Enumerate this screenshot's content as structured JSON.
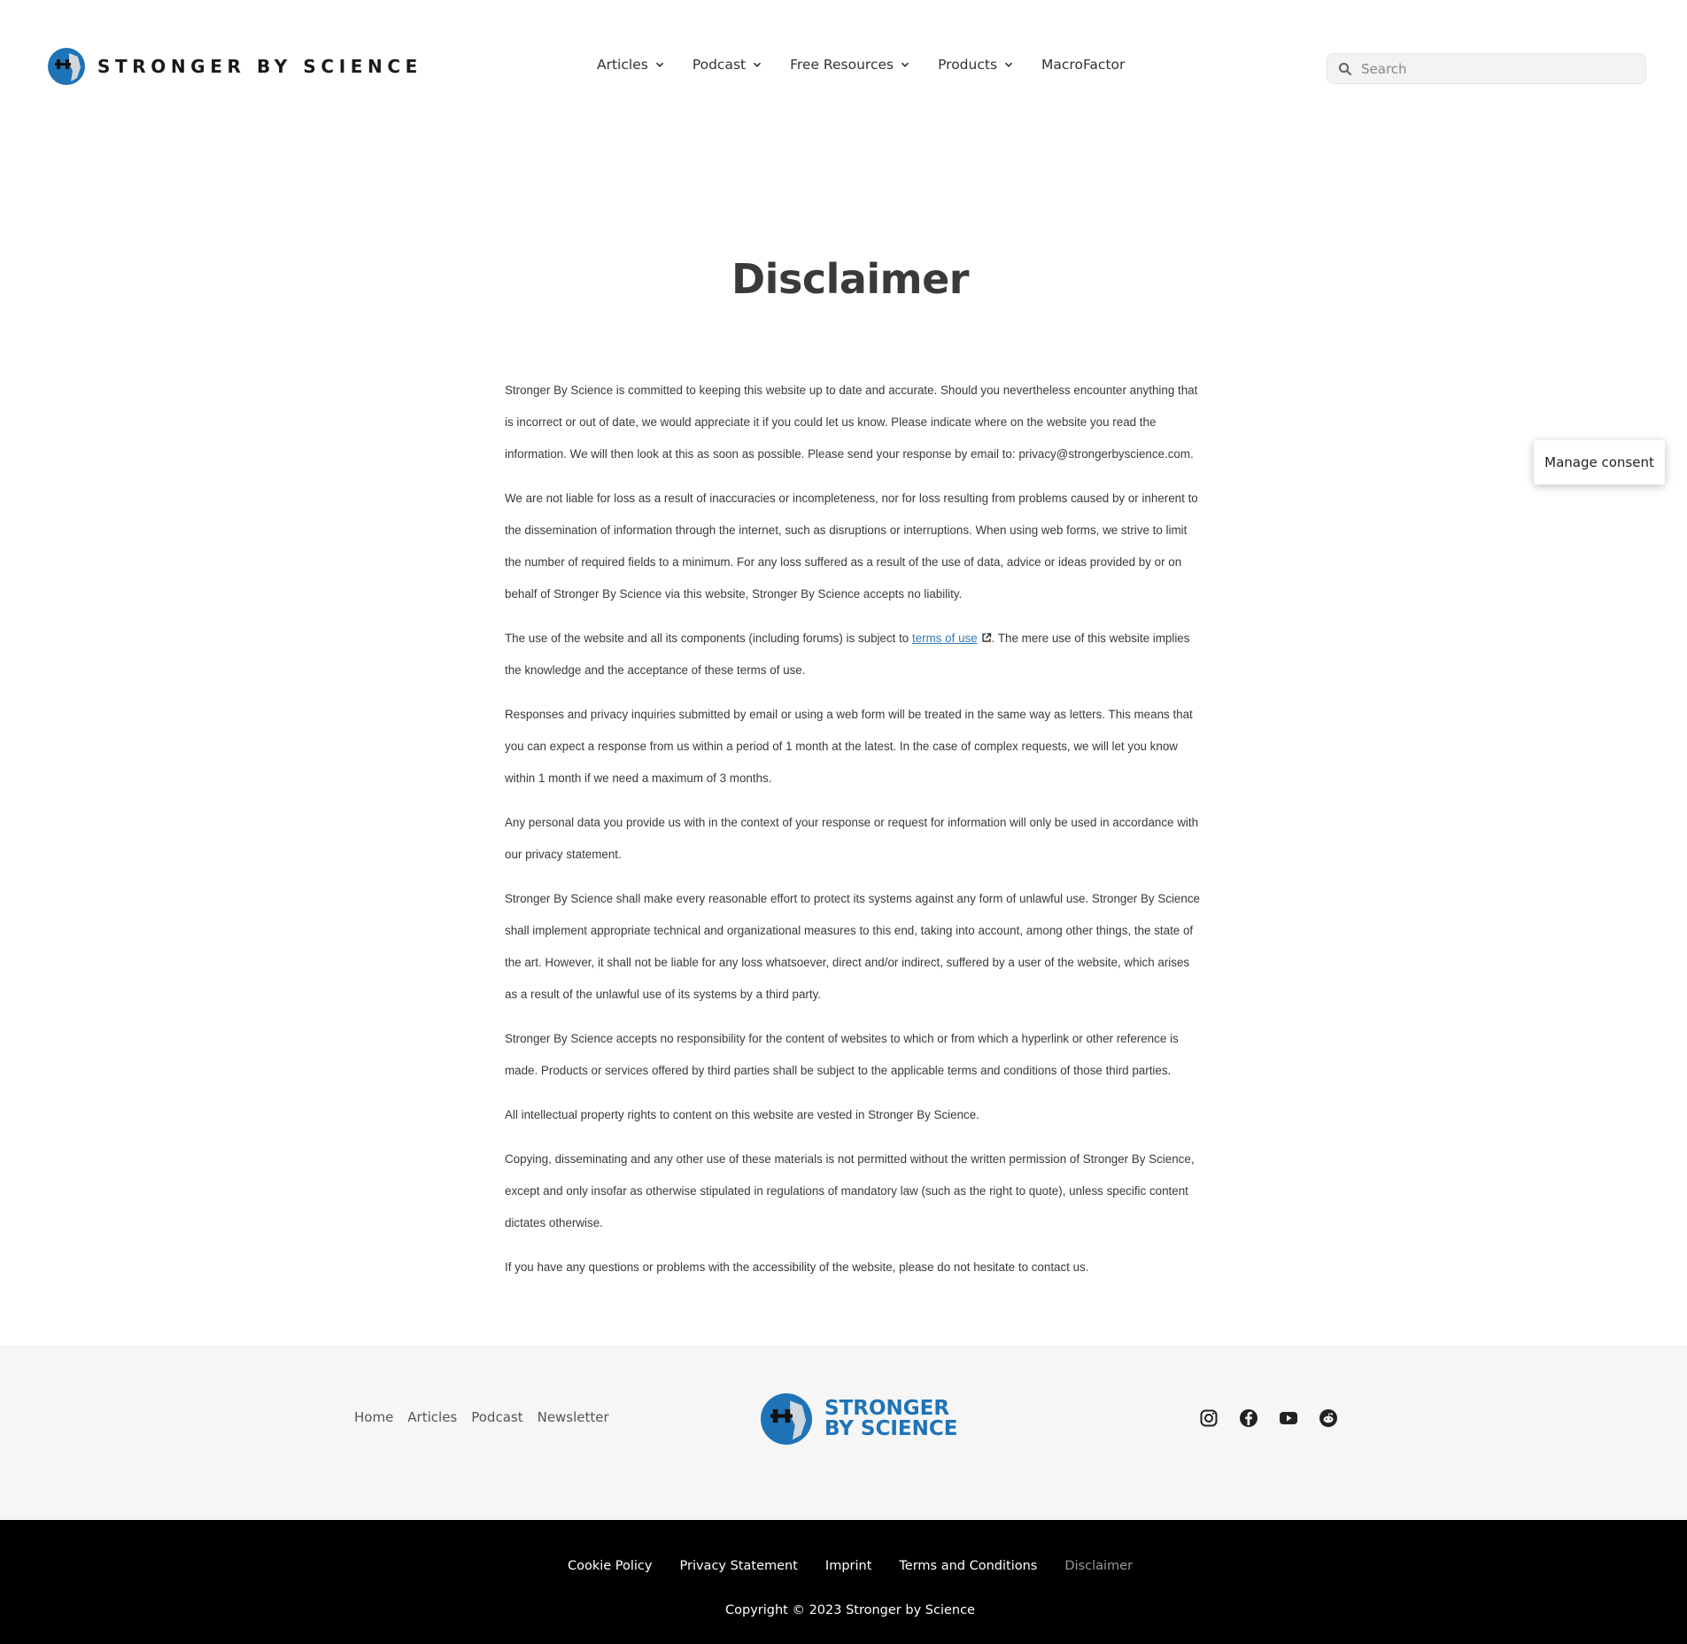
{
  "header": {
    "brand": "STRONGER BY SCIENCE",
    "nav": [
      {
        "label": "Articles",
        "dropdown": true
      },
      {
        "label": "Podcast",
        "dropdown": true
      },
      {
        "label": "Free Resources",
        "dropdown": true
      },
      {
        "label": "Products",
        "dropdown": true
      },
      {
        "label": "MacroFactor",
        "dropdown": false
      }
    ],
    "search_placeholder": "Search"
  },
  "page": {
    "title": "Disclaimer",
    "paragraphs": [
      "Stronger By Science is committed to keeping this website up to date and accurate. Should you nevertheless encounter anything that is incorrect or out of date, we would appreciate it if you could let us know. Please indicate where on the website you read the information. We will then look at this as soon as possible. Please send your response by email to: privacy@strongerbyscience.com.",
      "We are not liable for loss as a result of inaccuracies or incompleteness, nor for loss resulting from problems caused by or inherent to the dissemination of information through the internet, such as disruptions or interruptions. When using web forms, we strive to limit the number of required fields to a minimum. For any loss suffered as a result of the use of data, advice or ideas provided by or on behalf of Stronger By Science via this website, Stronger By Science accepts no liability.",
      {
        "before": "The use of the website and all its components (including forums) is subject to ",
        "link": "terms of use",
        "after": ". The mere use of this website implies the knowledge and the acceptance of these terms of use."
      },
      "Responses and privacy inquiries submitted by email or using a web form will be treated in the same way as letters. This means that you can expect a response from us within a period of 1 month at the latest. In the case of complex requests, we will let you know within 1 month if we need a maximum of 3 months.",
      "Any personal data you provide us with in the context of your response or request for information will only be used in accordance with our privacy statement.",
      "Stronger By Science shall make every reasonable effort to protect its systems against any form of unlawful use. Stronger By Science shall implement appropriate technical and organizational measures to this end, taking into account, among other things, the state of the art. However, it shall not be liable for any loss whatsoever, direct and/or indirect, suffered by a user of the website, which arises as a result of the unlawful use of its systems by a third party.",
      "Stronger By Science accepts no responsibility for the content of websites to which or from which a hyperlink or other reference is made. Products or services offered by third parties shall be subject to the applicable terms and conditions of those third parties.",
      "All intellectual property rights to content on this website are vested in Stronger By Science.",
      "Copying, disseminating and any other use of these materials is not permitted without the written permission of Stronger By Science, except and only insofar as otherwise stipulated in regulations of mandatory law (such as the right to quote), unless specific content dictates otherwise.",
      "If you have any questions or problems with the accessibility of the website, please do not hesitate to contact us."
    ]
  },
  "consent": {
    "label": "Manage consent"
  },
  "footer": {
    "links": [
      "Home",
      "Articles",
      "Podcast",
      "Newsletter"
    ],
    "logo_line1": "STRONGER",
    "logo_line2": "BY SCIENCE",
    "social_icons": [
      "instagram-icon",
      "facebook-icon",
      "youtube-icon",
      "reddit-icon"
    ],
    "legal_links": [
      "Cookie Policy",
      "Privacy Statement",
      "Imprint",
      "Terms and Conditions",
      "Disclaimer"
    ],
    "current_legal": "Disclaimer",
    "copyright": "Copyright © 2023 Stronger by Science"
  },
  "colors": {
    "brand_blue": "#1f73b7",
    "link": "#2e7bb8",
    "footer_dark": "#000000",
    "footer_light": "#f6f6f6"
  }
}
